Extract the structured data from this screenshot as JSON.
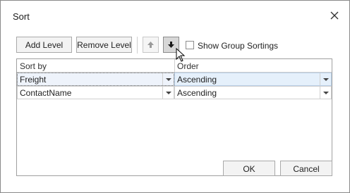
{
  "dialog": {
    "title": "Sort"
  },
  "toolbar": {
    "add_level": "Add Level",
    "remove_level": "Remove Level",
    "show_group_sortings": "Show Group Sortings",
    "move_up_icon": "arrow-up",
    "move_down_icon": "arrow-down",
    "show_group_sortings_checked": false
  },
  "grid": {
    "columns": [
      "Sort by",
      "Order"
    ],
    "rows": [
      {
        "sort_by": "Freight",
        "order": "Ascending"
      },
      {
        "sort_by": "ContactName",
        "order": "Ascending"
      }
    ]
  },
  "footer": {
    "ok": "OK",
    "cancel": "Cancel"
  },
  "colors": {
    "accent_selected": "#e5f0fb",
    "border": "#a0a0a0"
  }
}
